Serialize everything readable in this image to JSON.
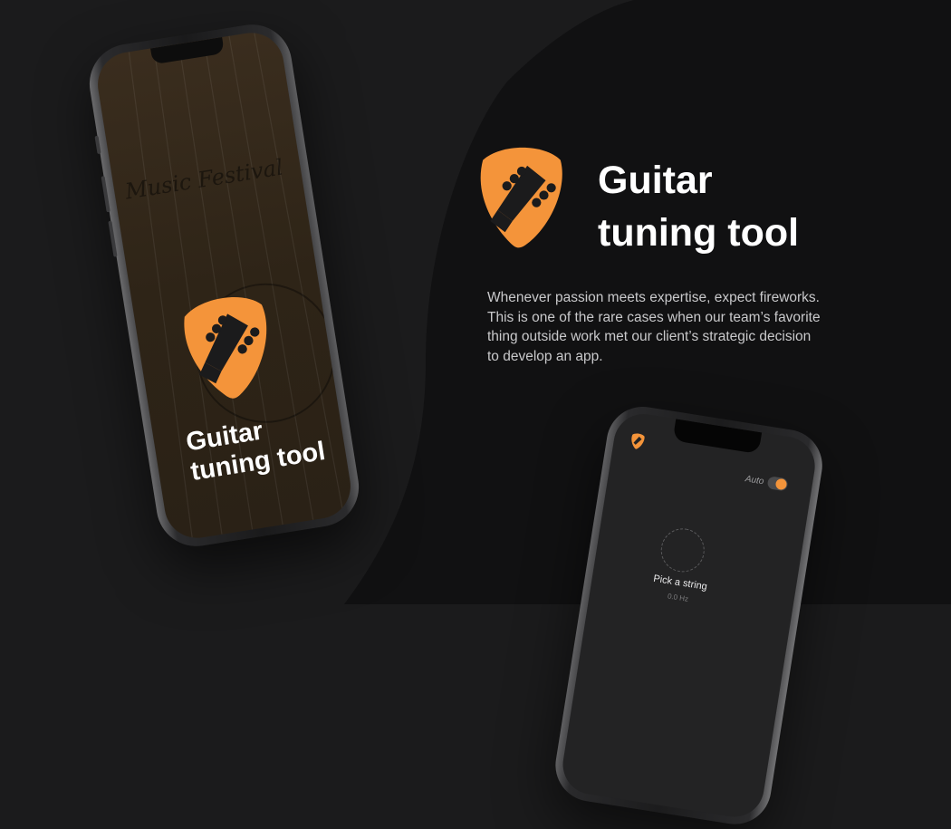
{
  "colors": {
    "background": "#1b1b1c",
    "accent_orange": "#f4943a",
    "text_primary": "#ffffff",
    "text_secondary": "#c9c9cb"
  },
  "left_phone": {
    "screen_text": "Music Festival",
    "title_line1": "Guitar",
    "title_line2": "tuning tool",
    "logo_icon": "guitar-pick-headstock-icon"
  },
  "hero": {
    "logo_icon": "guitar-pick-headstock-icon",
    "title_line1": "Guitar",
    "title_line2": "tuning tool",
    "description_lines": [
      "Whenever passion meets expertise, expect fireworks.",
      "This is one of the rare cases when our team’s favorite",
      "thing outside work met our client’s strategic decision",
      "to develop an app."
    ]
  },
  "right_phone": {
    "logo_icon": "guitar-pick-headstock-icon",
    "auto_label": "Auto",
    "auto_enabled": true,
    "pick_label": "Pick a string",
    "frequency": "0.0 Hz"
  }
}
